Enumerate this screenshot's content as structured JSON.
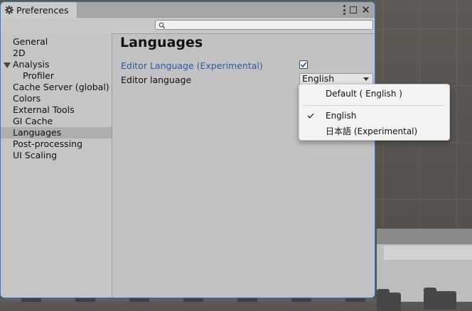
{
  "window": {
    "tab_title": "Preferences",
    "search": {
      "value": "",
      "placeholder": ""
    }
  },
  "sidebar": {
    "items": [
      {
        "label": "General"
      },
      {
        "label": "2D"
      },
      {
        "label": "Analysis",
        "expanded": true
      },
      {
        "label": "Profiler",
        "child": true
      },
      {
        "label": "Cache Server (global)"
      },
      {
        "label": "Colors"
      },
      {
        "label": "External Tools"
      },
      {
        "label": "GI Cache"
      },
      {
        "label": "Languages",
        "selected": true
      },
      {
        "label": "Post-processing"
      },
      {
        "label": "UI Scaling"
      }
    ]
  },
  "content": {
    "title": "Languages",
    "experimental_label": "Editor Language (Experimental)",
    "experimental_checked": true,
    "language_label": "Editor language",
    "language_value": "English"
  },
  "menu": {
    "items": [
      {
        "label": "Default ( English )",
        "checked": false
      },
      {
        "label": "English",
        "checked": true
      },
      {
        "label": "日本語 (Experimental)",
        "checked": false
      }
    ]
  },
  "colors": {
    "window_border": "#2f7bcf",
    "link_blue": "#2a5aa0",
    "selected_bg": "#aeaeae"
  },
  "icons": [
    "gear-icon",
    "kebab-menu-icon",
    "maximize-icon",
    "close-icon",
    "search-icon",
    "checkmark-icon",
    "dropdown-arrow-icon",
    "foldout-triangle-icon",
    "folder-icon"
  ]
}
